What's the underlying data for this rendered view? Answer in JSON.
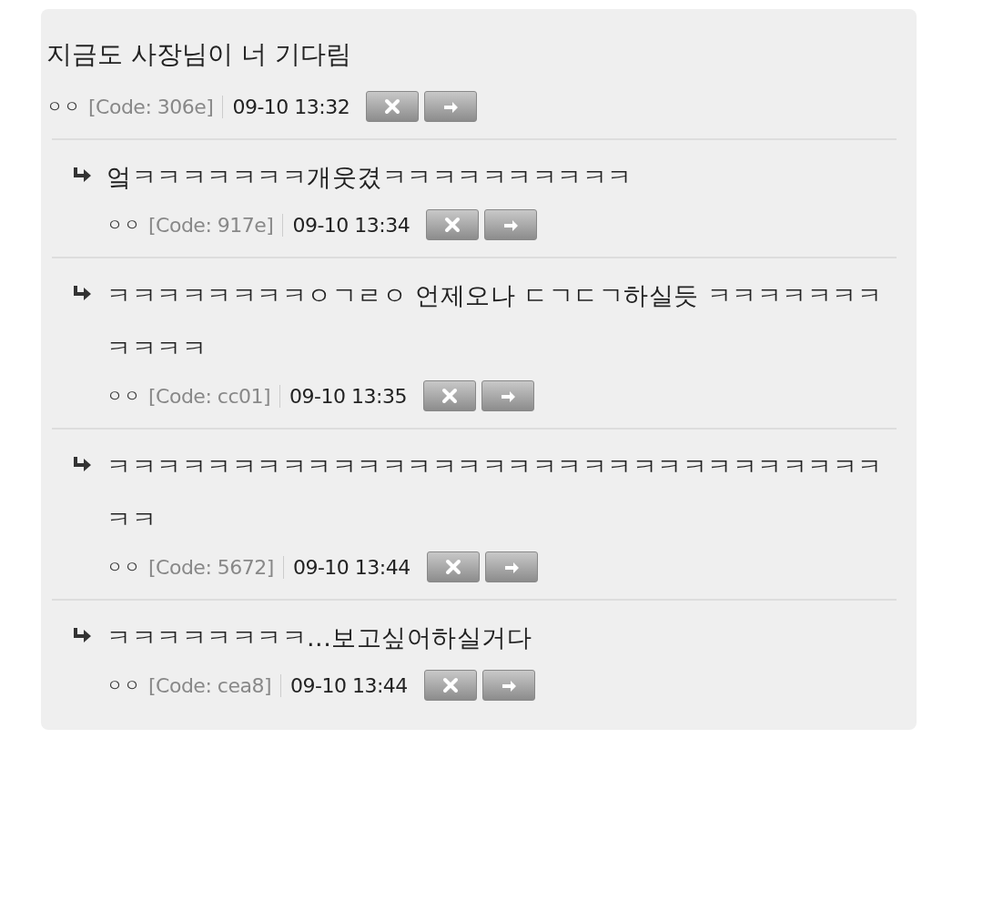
{
  "post": {
    "title": "지금도 사장님이 너 기다림",
    "author": "ㅇㅇ",
    "code": "[Code: 306e]",
    "time": "09-10 13:32"
  },
  "replies": [
    {
      "text": "엌ㅋㅋㅋㅋㅋㅋㅋ개웃겼ㅋㅋㅋㅋㅋㅋㅋㅋㅋㅋ",
      "author": "ㅇㅇ",
      "code": "[Code: 917e]",
      "time": "09-10 13:34"
    },
    {
      "text": "ㅋㅋㅋㅋㅋㅋㅋㅋㅇㄱㄹㅇ 언제오나 ㄷㄱㄷㄱ하실듯 ㅋㅋㅋㅋㅋㅋㅋㅋㅋㅋㅋ",
      "author": "ㅇㅇ",
      "code": "[Code: cc01]",
      "time": "09-10 13:35"
    },
    {
      "text": "ㅋㅋㅋㅋㅋㅋㅋㅋㅋㅋㅋㅋㅋㅋㅋㅋㅋㅋㅋㅋㅋㅋㅋㅋㅋㅋㅋㅋㅋㅋㅋㅋㅋ",
      "author": "ㅇㅇ",
      "code": "[Code: 5672]",
      "time": "09-10 13:44"
    },
    {
      "text": "ㅋㅋㅋㅋㅋㅋㅋㅋ...보고싶어하실거다",
      "author": "ㅇㅇ",
      "code": "[Code: cea8]",
      "time": "09-10 13:44"
    }
  ]
}
